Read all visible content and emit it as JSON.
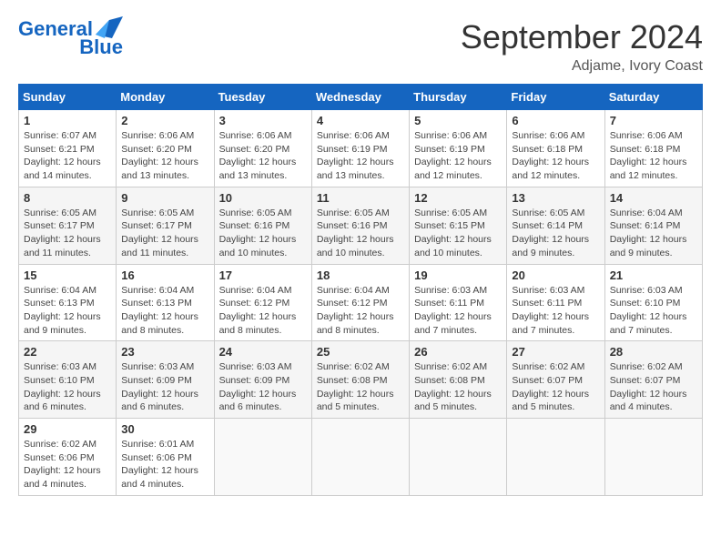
{
  "header": {
    "logo_line1": "General",
    "logo_line2": "Blue",
    "month": "September 2024",
    "location": "Adjame, Ivory Coast"
  },
  "days_of_week": [
    "Sunday",
    "Monday",
    "Tuesday",
    "Wednesday",
    "Thursday",
    "Friday",
    "Saturday"
  ],
  "weeks": [
    [
      {
        "day": "1",
        "sunrise": "6:07 AM",
        "sunset": "6:21 PM",
        "daylight": "12 hours and 14 minutes."
      },
      {
        "day": "2",
        "sunrise": "6:06 AM",
        "sunset": "6:20 PM",
        "daylight": "12 hours and 13 minutes."
      },
      {
        "day": "3",
        "sunrise": "6:06 AM",
        "sunset": "6:20 PM",
        "daylight": "12 hours and 13 minutes."
      },
      {
        "day": "4",
        "sunrise": "6:06 AM",
        "sunset": "6:19 PM",
        "daylight": "12 hours and 13 minutes."
      },
      {
        "day": "5",
        "sunrise": "6:06 AM",
        "sunset": "6:19 PM",
        "daylight": "12 hours and 12 minutes."
      },
      {
        "day": "6",
        "sunrise": "6:06 AM",
        "sunset": "6:18 PM",
        "daylight": "12 hours and 12 minutes."
      },
      {
        "day": "7",
        "sunrise": "6:06 AM",
        "sunset": "6:18 PM",
        "daylight": "12 hours and 12 minutes."
      }
    ],
    [
      {
        "day": "8",
        "sunrise": "6:05 AM",
        "sunset": "6:17 PM",
        "daylight": "12 hours and 11 minutes."
      },
      {
        "day": "9",
        "sunrise": "6:05 AM",
        "sunset": "6:17 PM",
        "daylight": "12 hours and 11 minutes."
      },
      {
        "day": "10",
        "sunrise": "6:05 AM",
        "sunset": "6:16 PM",
        "daylight": "12 hours and 10 minutes."
      },
      {
        "day": "11",
        "sunrise": "6:05 AM",
        "sunset": "6:16 PM",
        "daylight": "12 hours and 10 minutes."
      },
      {
        "day": "12",
        "sunrise": "6:05 AM",
        "sunset": "6:15 PM",
        "daylight": "12 hours and 10 minutes."
      },
      {
        "day": "13",
        "sunrise": "6:05 AM",
        "sunset": "6:14 PM",
        "daylight": "12 hours and 9 minutes."
      },
      {
        "day": "14",
        "sunrise": "6:04 AM",
        "sunset": "6:14 PM",
        "daylight": "12 hours and 9 minutes."
      }
    ],
    [
      {
        "day": "15",
        "sunrise": "6:04 AM",
        "sunset": "6:13 PM",
        "daylight": "12 hours and 9 minutes."
      },
      {
        "day": "16",
        "sunrise": "6:04 AM",
        "sunset": "6:13 PM",
        "daylight": "12 hours and 8 minutes."
      },
      {
        "day": "17",
        "sunrise": "6:04 AM",
        "sunset": "6:12 PM",
        "daylight": "12 hours and 8 minutes."
      },
      {
        "day": "18",
        "sunrise": "6:04 AM",
        "sunset": "6:12 PM",
        "daylight": "12 hours and 8 minutes."
      },
      {
        "day": "19",
        "sunrise": "6:03 AM",
        "sunset": "6:11 PM",
        "daylight": "12 hours and 7 minutes."
      },
      {
        "day": "20",
        "sunrise": "6:03 AM",
        "sunset": "6:11 PM",
        "daylight": "12 hours and 7 minutes."
      },
      {
        "day": "21",
        "sunrise": "6:03 AM",
        "sunset": "6:10 PM",
        "daylight": "12 hours and 7 minutes."
      }
    ],
    [
      {
        "day": "22",
        "sunrise": "6:03 AM",
        "sunset": "6:10 PM",
        "daylight": "12 hours and 6 minutes."
      },
      {
        "day": "23",
        "sunrise": "6:03 AM",
        "sunset": "6:09 PM",
        "daylight": "12 hours and 6 minutes."
      },
      {
        "day": "24",
        "sunrise": "6:03 AM",
        "sunset": "6:09 PM",
        "daylight": "12 hours and 6 minutes."
      },
      {
        "day": "25",
        "sunrise": "6:02 AM",
        "sunset": "6:08 PM",
        "daylight": "12 hours and 5 minutes."
      },
      {
        "day": "26",
        "sunrise": "6:02 AM",
        "sunset": "6:08 PM",
        "daylight": "12 hours and 5 minutes."
      },
      {
        "day": "27",
        "sunrise": "6:02 AM",
        "sunset": "6:07 PM",
        "daylight": "12 hours and 5 minutes."
      },
      {
        "day": "28",
        "sunrise": "6:02 AM",
        "sunset": "6:07 PM",
        "daylight": "12 hours and 4 minutes."
      }
    ],
    [
      {
        "day": "29",
        "sunrise": "6:02 AM",
        "sunset": "6:06 PM",
        "daylight": "12 hours and 4 minutes."
      },
      {
        "day": "30",
        "sunrise": "6:01 AM",
        "sunset": "6:06 PM",
        "daylight": "12 hours and 4 minutes."
      },
      null,
      null,
      null,
      null,
      null
    ]
  ]
}
